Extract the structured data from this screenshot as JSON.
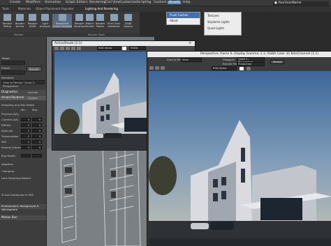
{
  "menubar": {
    "items": [
      "Create",
      "Modifiers",
      "Animation",
      "Graph Editors",
      "Rendering",
      "Civil View",
      "Customize",
      "Scripting",
      "Content",
      "Arnold",
      "Help"
    ],
    "user": "YourUserName"
  },
  "ribbon": {
    "tabs": [
      "Tools",
      "Materials",
      "Object Placement",
      "Populate",
      "Lighting And Rendering"
    ],
    "buttons": [
      "Render Setup",
      "Render Active",
      "Render A360",
      "Light Analysis",
      "Rendered Frame Window",
      "Render Iterative",
      "Batch Render",
      "Print Size Assistant",
      "A360 Gallery",
      "Render Player"
    ],
    "footer_left": "Render",
    "footer_right": "Render Tools"
  },
  "arnold_menu": {
    "items": [
      "Flush Caches",
      "About"
    ]
  },
  "sub_menu": {
    "items": [
      "Textures",
      "Skydome Lights",
      "Quad Lights"
    ]
  },
  "left_panel": {
    "target": "Target:",
    "preset": "Preset:",
    "renderer": "Renderer:",
    "view": "View to Render: Quad 4 - Perspective",
    "render_label": "Render",
    "tabs": [
      "Diagnostics",
      "Archive",
      "Arnold Renderer",
      "System"
    ],
    "sampling_label": "Sampling and Ray Depth",
    "min_label": "Min",
    "max_label": "Max",
    "preview_label": "Preview (AA):",
    "rows": [
      "Camera (AA)",
      "Diffuse",
      "Specular",
      "Transmission",
      "SSS",
      "Volume Indirect"
    ],
    "values_a": [
      "3",
      "2",
      "2",
      "2",
      "2",
      "0"
    ],
    "values_b": [
      "9",
      "4",
      "4",
      "4",
      "4",
      "0"
    ],
    "ray_depth_label": "Ray Depth",
    "adaptive": "Adaptive",
    "clamp_label": "Clamping",
    "lock_label": "Lock Sampling Pattern",
    "use_autobump": "Use Autobump in SSS",
    "env_section": "Environment, Background & Atmosphere",
    "motion_section": "Motion Blur"
  },
  "activeshade": {
    "title": "ActiveShade (1:1)",
    "channel": "RGB Alpha",
    "display": "RGBA"
  },
  "framebuffer": {
    "title": "Perspective, frame 0, Display Gamma: 2.2, RGBA Color 32 Bits/Channel (1:1)",
    "area_label": "Area to Render:",
    "viewport_label": "Viewport:",
    "preset_label": "Render Preset:",
    "render_label": "Render",
    "view_value": "View",
    "quad_value": "Quad 4 - Perspective",
    "production_value": "Production",
    "channel": "RGB Alpha"
  }
}
